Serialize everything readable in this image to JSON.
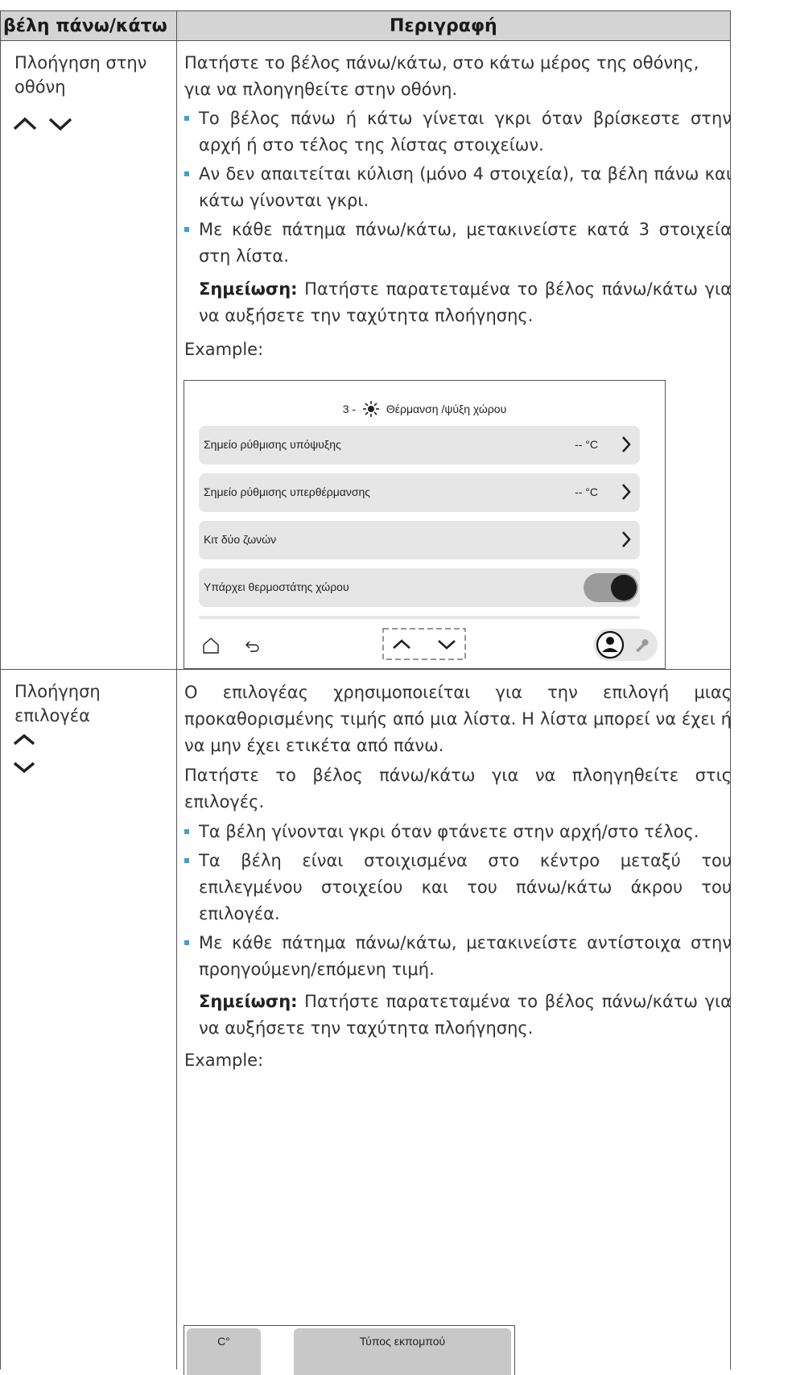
{
  "table": {
    "header": {
      "col1": "βέλη πάνω/κάτω",
      "col2": "Περιγραφή"
    },
    "row1": {
      "label_line1": "Πλοήγηση στην",
      "label_line2": "οθόνη",
      "intro_line1": "Πατήστε το βέλος πάνω/κάτω, στο κάτω μέρος της οθόνης,",
      "intro_line2": "για να πλοηγηθείτε στην οθόνη.",
      "bullets": [
        "Το βέλος πάνω ή κάτω γίνεται γκρι όταν βρίσκεστε στην αρχή ή στο τέλος της λίστας στοιχείων.",
        "Αν δεν απαιτείται κύλιση (μόνο 4 στοιχεία), τα βέλη πάνω και κάτω γίνονται γκρι.",
        "Με κάθε πάτημα πάνω/κάτω, μετακινείστε κατά 3 στοιχεία στη λίστα."
      ],
      "note_label": "Σημείωση:",
      "note_text": " Πατήστε παρατεταμένα το βέλος πάνω/κάτω για να αυξήσετε την ταχύτητα πλοήγησης.",
      "example_label": "Example:"
    },
    "row2": {
      "label_line1": "Πλοήγηση",
      "label_line2": "επιλογέα",
      "intro": "Ο επιλογέας χρησιμοποιείται για την επιλογή μιας προκαθορισμένης τιμής από μια λίστα. Η λίστα μπορεί να έχει ή να μην έχει ετικέτα από πάνω.",
      "intro2": "Πατήστε το βέλος πάνω/κάτω για να πλοηγηθείτε στις επιλογές.",
      "bullets": [
        "Τα βέλη γίνονται γκρι όταν φτάνετε στην αρχή/στο τέλος.",
        "Τα βέλη είναι στοιχισμένα στο κέντρο μεταξύ του επιλεγμένου στοιχείου και του πάνω/κάτω άκρου του επιλογέα.",
        "Με κάθε πάτημα πάνω/κάτω, μετακινείστε αντίστοιχα στην προηγούμενη/επόμενη τιμή."
      ],
      "note_label": "Σημείωση:",
      "note_text": " Πατήστε παρατεταμένα το βέλος πάνω/κάτω για να αυξήσετε την ταχύτητα πλοήγησης.",
      "example_label": "Example:"
    }
  },
  "screen1": {
    "title_prefix": "3 -",
    "title": "Θέρμανση /ψύξη χώρου",
    "rows": [
      {
        "label": "Σημείο ρύθμισης υπόψυξης",
        "value": "-- °C"
      },
      {
        "label": "Σημείο ρύθμισης υπερθέρμανσης",
        "value": "-- °C"
      },
      {
        "label": "Κιτ δύο ζωνών",
        "value": ""
      },
      {
        "label": "Υπάρχει θερμοστάτης χώρου",
        "toggle_on": true
      }
    ]
  },
  "screen2": {
    "left_header": "C°",
    "right_header": "Τύπος εκπομπού"
  },
  "colors": {
    "bullet": "#3aa0d6",
    "header_bg": "#d4d4d4",
    "row_bg": "#e6e6e6"
  }
}
